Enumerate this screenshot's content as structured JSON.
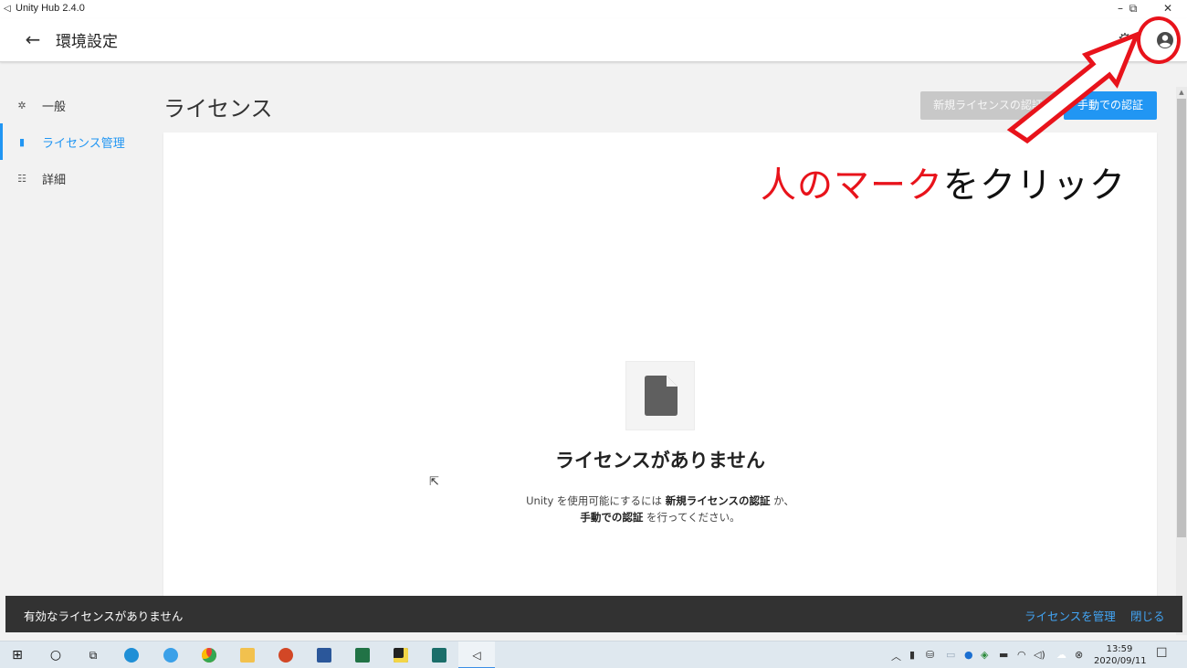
{
  "window": {
    "title": "Unity Hub 2.4.0",
    "app_icon": "◁",
    "minimize": "–",
    "restore": "⧉",
    "close": "✕"
  },
  "header": {
    "back": "←",
    "title": "環境設定",
    "gear": "⚙"
  },
  "sidebar": {
    "items": [
      {
        "icon": "✲",
        "label": "一般",
        "active": false
      },
      {
        "icon": "▮",
        "label": "ライセンス管理",
        "active": true
      },
      {
        "icon": "☷",
        "label": "詳細",
        "active": false
      }
    ]
  },
  "main": {
    "title": "ライセンス",
    "new_license_button": "新規ライセンスの認証",
    "manual_button": "手動での認証",
    "empty_title": "ライセンスがありません",
    "desc_prefix": "Unity を使用可能にするには",
    "desc_bold1": "新規ライセンスの認証",
    "desc_mid": "か、",
    "desc_bold2": "手動での認証",
    "desc_suffix": "を行ってください。"
  },
  "snackbar": {
    "message": "有効なライセンスがありません",
    "manage": "ライセンスを管理",
    "close": "閉じる"
  },
  "annotation": {
    "text_red": "人のマーク",
    "text_black": "をクリック",
    "color": "#e8131b"
  },
  "taskbar": {
    "start": "⊞",
    "search": "○",
    "taskview": "⧉",
    "tray_up": "︿",
    "time": "13:59",
    "date": "2020/09/11",
    "notification": "☐"
  },
  "colors": {
    "accent": "#2196f3",
    "snackbar_bg": "#323232",
    "disabled_button": "#c8c8c8"
  }
}
